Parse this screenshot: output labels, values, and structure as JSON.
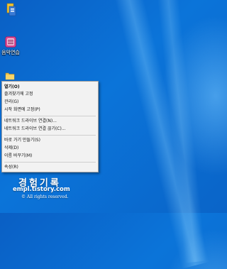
{
  "desktop": {
    "icons": [
      {
        "name": "top-app-icon",
        "label": ""
      },
      {
        "name": "music-app-icon",
        "label": "음악연습"
      },
      {
        "name": "folder-icon",
        "label": ""
      }
    ]
  },
  "context_menu": {
    "items": [
      {
        "label": "열기(O)",
        "bold": true
      },
      {
        "label": "즐겨찾기에 고정"
      },
      {
        "label": "관리(G)"
      },
      {
        "label": "시작 화면에 고정(P)"
      },
      {
        "label": "네트워크 드라이브 연결(N)..."
      },
      {
        "label": "네트워크 드라이브 연결 끊기(C)..."
      },
      {
        "label": "바로 가기 만들기(S)"
      },
      {
        "label": "삭제(D)"
      },
      {
        "label": "이름 바꾸기(M)"
      },
      {
        "label": "속성(R)"
      }
    ]
  },
  "watermark": {
    "title": "경험기록",
    "url": "empl.tistory.com",
    "copyright": "© All rights reserved."
  },
  "colors": {
    "desktop_blue": "#0b74d9",
    "menu_bg": "#f2f2f2"
  }
}
